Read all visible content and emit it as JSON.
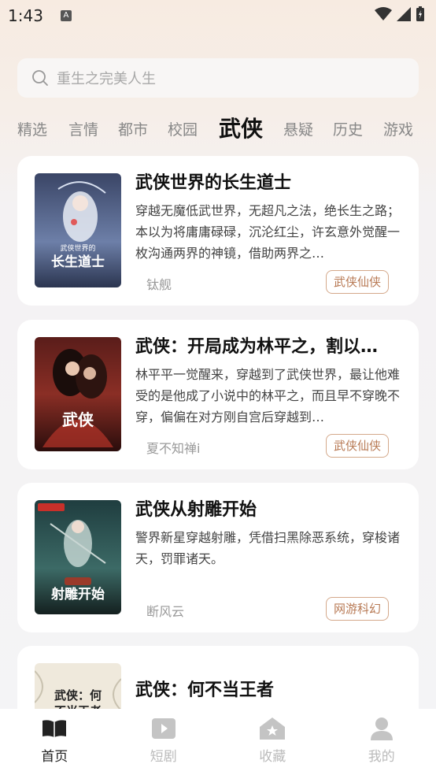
{
  "status": {
    "time": "1:43",
    "notification_icon": "A"
  },
  "search": {
    "placeholder": "重生之完美人生"
  },
  "categories": [
    "精选",
    "言情",
    "都市",
    "校园",
    "武侠",
    "悬疑",
    "历史",
    "游戏"
  ],
  "active_category": "武侠",
  "books": [
    {
      "title": "武侠世界的长生道士",
      "description": "穿越无魔低武世界，无超凡之法，绝长生之路；本以为将庸庸碌碌，沉沦红尘，许玄意外觉醒一枚沟通两界的神镜，借助两界之…",
      "author": "钛舰",
      "tag": "武侠仙侠",
      "cover_text": "武侠世界的长生道士"
    },
    {
      "title": "武侠：开局成为林平之，割以…",
      "description": "林平平一觉醒来，穿越到了武侠世界，最让他难受的是他成了小说中的林平之，而且早不穿晚不穿，偏偏在对方刚自宫后穿越到…",
      "author": "夏不知禅i",
      "tag": "武侠仙侠",
      "cover_text": "武侠"
    },
    {
      "title": "武侠从射雕开始",
      "description": "警界新星穿越射雕，凭借扫黑除恶系统，穿梭诸天，罚罪诸天。",
      "author": "断风云",
      "tag": "网游科幻",
      "cover_text": "武侠从射雕开始"
    },
    {
      "title": "武侠：何不当王者",
      "description": "",
      "author": "",
      "tag": "",
      "cover_text": "武侠：何不当王者"
    }
  ],
  "nav": [
    {
      "label": "首页",
      "icon": "book-open-icon",
      "active": true
    },
    {
      "label": "短剧",
      "icon": "play-icon",
      "active": false
    },
    {
      "label": "收藏",
      "icon": "star-house-icon",
      "active": false
    },
    {
      "label": "我的",
      "icon": "user-icon",
      "active": false
    }
  ],
  "colors": {
    "accent": "#b87a55",
    "active_text": "#111111",
    "inactive_text": "#888888"
  }
}
